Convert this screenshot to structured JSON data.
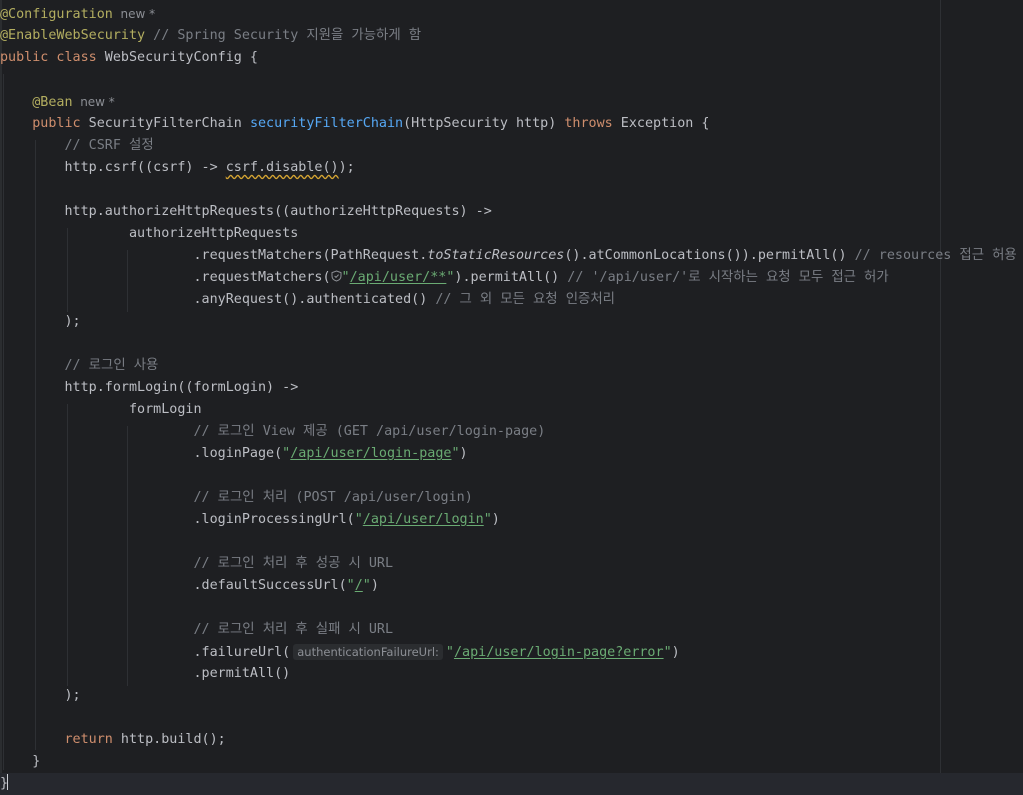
{
  "editor": {
    "lines": [
      [
        {
          "c": "ann",
          "t": "@Configuration"
        },
        {
          "c": "hint",
          "t": "  new *"
        }
      ],
      [
        {
          "c": "ann",
          "t": "@EnableWebSecurity"
        },
        {
          "c": "cm",
          "t": " // Spring Security 지원을 가능하게 함"
        }
      ],
      [
        {
          "c": "kw",
          "t": "public class"
        },
        {
          "t": " WebSecurityConfig {"
        }
      ],
      [],
      [
        {
          "t": "    "
        },
        {
          "c": "ann",
          "t": "@Bean"
        },
        {
          "c": "hint",
          "t": "  new *"
        }
      ],
      [
        {
          "t": "    "
        },
        {
          "c": "kw",
          "t": "public"
        },
        {
          "t": " SecurityFilterChain "
        },
        {
          "c": "fn",
          "t": "securityFilterChain"
        },
        {
          "t": "(HttpSecurity http) "
        },
        {
          "c": "kw",
          "t": "throws"
        },
        {
          "t": " Exception {"
        }
      ],
      [
        {
          "t": "        "
        },
        {
          "c": "cm",
          "t": "// CSRF 설정"
        }
      ],
      [
        {
          "t": "        http.csrf((csrf) -> "
        },
        {
          "c": "warn",
          "t": "csrf.disable()"
        },
        {
          "t": ");"
        }
      ],
      [],
      [
        {
          "t": "        http.authorizeHttpRequests((authorizeHttpRequests) ->"
        }
      ],
      [
        {
          "t": "                authorizeHttpRequests"
        }
      ],
      [
        {
          "t": "                        .requestMatchers(PathRequest."
        },
        {
          "c": "it",
          "t": "toStaticResources"
        },
        {
          "t": "().atCommonLocations()).permitAll() "
        },
        {
          "c": "cm",
          "t": "// resources 접근 허용 설정"
        }
      ],
      [
        {
          "t": "                        .requestMatchers("
        },
        {
          "c": "shield",
          "t": ""
        },
        {
          "c": "str",
          "t": "\""
        },
        {
          "c": "str ul",
          "t": "/api/user/**"
        },
        {
          "c": "str",
          "t": "\""
        },
        {
          "t": ").permitAll() "
        },
        {
          "c": "cm",
          "t": "// '/api/user/'로 시작하는 요청 모두 접근 허가"
        }
      ],
      [
        {
          "t": "                        .anyRequest().authenticated() "
        },
        {
          "c": "cm",
          "t": "// 그 외 모든 요청 인증처리"
        }
      ],
      [
        {
          "t": "        );"
        }
      ],
      [],
      [
        {
          "t": "        "
        },
        {
          "c": "cm",
          "t": "// 로그인 사용"
        }
      ],
      [
        {
          "t": "        http.formLogin((formLogin) ->"
        }
      ],
      [
        {
          "t": "                formLogin"
        }
      ],
      [
        {
          "t": "                        "
        },
        {
          "c": "cm",
          "t": "// 로그인 View 제공 (GET /api/user/login-page)"
        }
      ],
      [
        {
          "t": "                        .loginPage("
        },
        {
          "c": "str",
          "t": "\""
        },
        {
          "c": "str ul",
          "t": "/api/user/login-page"
        },
        {
          "c": "str",
          "t": "\""
        },
        {
          "t": ")"
        }
      ],
      [],
      [
        {
          "t": "                        "
        },
        {
          "c": "cm",
          "t": "// 로그인 처리 (POST /api/user/login)"
        }
      ],
      [
        {
          "t": "                        .loginProcessingUrl("
        },
        {
          "c": "str",
          "t": "\""
        },
        {
          "c": "str ul",
          "t": "/api/user/login"
        },
        {
          "c": "str",
          "t": "\""
        },
        {
          "t": ")"
        }
      ],
      [],
      [
        {
          "t": "                        "
        },
        {
          "c": "cm",
          "t": "// 로그인 처리 후 성공 시 URL"
        }
      ],
      [
        {
          "t": "                        .defaultSuccessUrl("
        },
        {
          "c": "str",
          "t": "\""
        },
        {
          "c": "str ul",
          "t": "/"
        },
        {
          "c": "str",
          "t": "\""
        },
        {
          "t": ")"
        }
      ],
      [],
      [
        {
          "t": "                        "
        },
        {
          "c": "cm",
          "t": "// 로그인 처리 후 실패 시 URL"
        }
      ],
      [
        {
          "t": "                        .failureUrl("
        },
        {
          "c": "inlay",
          "t": "authenticationFailureUrl:"
        },
        {
          "c": "str",
          "t": "\""
        },
        {
          "c": "str ul",
          "t": "/api/user/login-page?error"
        },
        {
          "c": "str",
          "t": "\""
        },
        {
          "t": ")"
        }
      ],
      [
        {
          "t": "                        .permitAll()"
        }
      ],
      [
        {
          "t": "        );"
        }
      ],
      [],
      [
        {
          "t": "        "
        },
        {
          "c": "kw",
          "t": "return"
        },
        {
          "t": " http.build();"
        }
      ],
      [
        {
          "t": "    }"
        }
      ],
      [
        {
          "t": "}"
        },
        {
          "c": "caret",
          "t": ""
        }
      ]
    ],
    "caret_line": 35
  }
}
